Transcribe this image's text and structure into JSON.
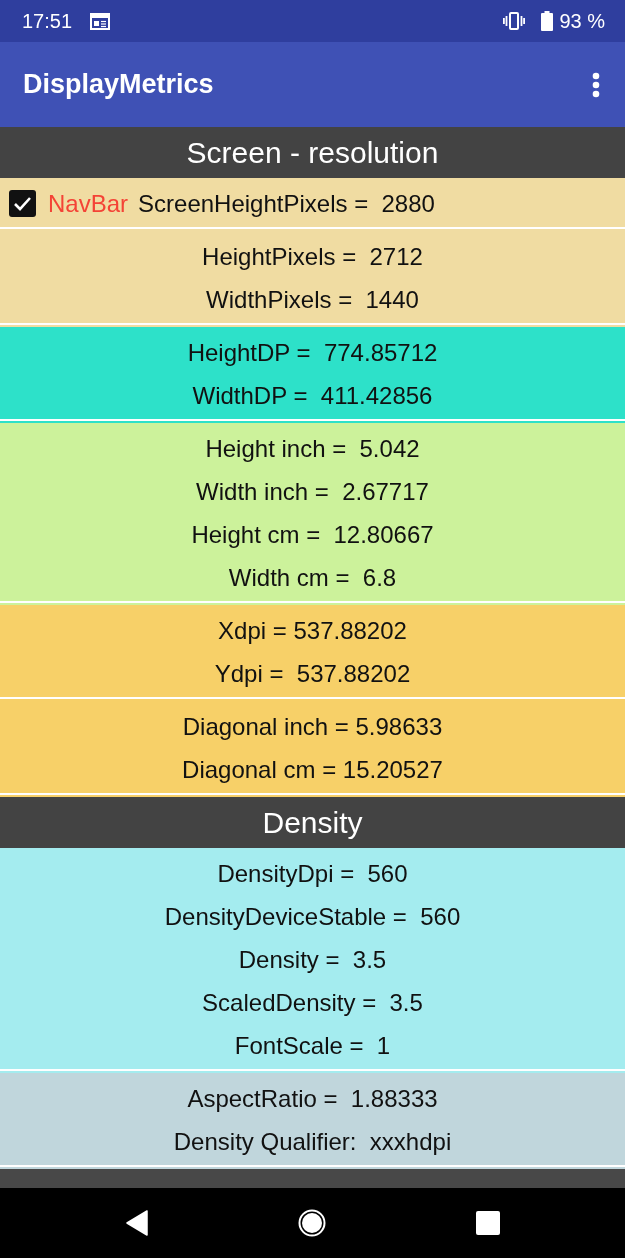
{
  "status_bar": {
    "time": "17:51",
    "battery": "93 %"
  },
  "app_bar": {
    "title": "DisplayMetrics"
  },
  "sections": [
    {
      "title": "Screen - resolution",
      "groups": [
        {
          "color": "#f0dca2",
          "rows": [
            {
              "kind": "toggle",
              "label": "NavBar",
              "checked": true,
              "text": "ScreenHeightPixels =  2880"
            }
          ]
        },
        {
          "color": "#f0dca2",
          "rows": [
            {
              "kind": "text",
              "text": "HeightPixels =  2712"
            },
            {
              "kind": "text",
              "text": "WidthPixels =  1440"
            }
          ]
        },
        {
          "color": "#2de1c9",
          "rows": [
            {
              "kind": "text",
              "text": "HeightDP =  774.85712"
            },
            {
              "kind": "text",
              "text": "WidthDP =  411.42856"
            }
          ]
        },
        {
          "color": "#ccf29b",
          "rows": [
            {
              "kind": "text",
              "text": "Height inch =  5.042"
            },
            {
              "kind": "text",
              "text": "Width inch =  2.67717"
            },
            {
              "kind": "text",
              "text": "Height cm =  12.80667"
            },
            {
              "kind": "text",
              "text": "Width cm =  6.8"
            }
          ]
        },
        {
          "color": "#f7d068",
          "rows": [
            {
              "kind": "text",
              "text": "Xdpi = 537.88202"
            },
            {
              "kind": "text",
              "text": "Ydpi =  537.88202"
            }
          ]
        },
        {
          "color": "#f7d068",
          "rows": [
            {
              "kind": "text",
              "text": "Diagonal inch = 5.98633"
            },
            {
              "kind": "text",
              "text": "Diagonal cm = 15.20527"
            }
          ]
        }
      ]
    },
    {
      "title": "Density",
      "groups": [
        {
          "color": "#a4ecef",
          "rows": [
            {
              "kind": "text",
              "text": "DensityDpi =  560"
            },
            {
              "kind": "text",
              "text": "DensityDeviceStable =  560"
            },
            {
              "kind": "text",
              "text": "Density =  3.5"
            },
            {
              "kind": "text",
              "text": "ScaledDensity =  3.5"
            },
            {
              "kind": "text",
              "text": "FontScale =  1"
            }
          ]
        },
        {
          "color": "#c0d6dc",
          "rows": [
            {
              "kind": "text",
              "text": "AspectRatio =  1.88333"
            },
            {
              "kind": "text",
              "text": "Density Qualifier:  xxxhdpi"
            }
          ]
        }
      ]
    }
  ]
}
